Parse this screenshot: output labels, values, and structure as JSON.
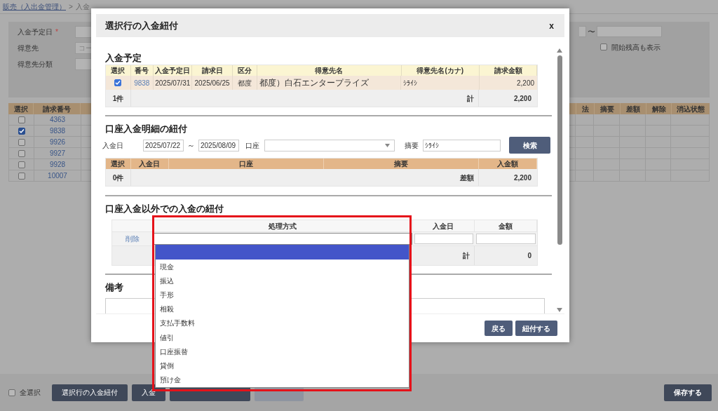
{
  "breadcrumb": {
    "link": "販売（入出金管理）",
    "separator": ">",
    "current": "入金"
  },
  "filter": {
    "fields": [
      {
        "label": "入金予定日",
        "required_mark": "*"
      },
      {
        "label": "得意先",
        "placeholder": "コー"
      },
      {
        "label": "得意先分類"
      }
    ],
    "range_separator": "〜",
    "opening_balance": {
      "label": "開始残高も表示",
      "checked": false
    }
  },
  "list": {
    "columns_left": [
      "選択",
      "請求番号"
    ],
    "columns_right": [
      "法",
      "摘要",
      "差額",
      "解除",
      "消込状態"
    ],
    "rows": [
      {
        "checked": false,
        "number": "4363"
      },
      {
        "checked": true,
        "number": "9838"
      },
      {
        "checked": false,
        "number": "9926"
      },
      {
        "checked": false,
        "number": "9927"
      },
      {
        "checked": false,
        "number": "9928"
      },
      {
        "checked": false,
        "number": "10007"
      }
    ]
  },
  "modal": {
    "title": "選択行の入金紐付",
    "close": "x",
    "schedule": {
      "heading": "入金予定",
      "columns": [
        "選択",
        "番号",
        "入金予定日",
        "請求日",
        "区分",
        "得意先名",
        "得意先名(カナ)",
        "請求金額"
      ],
      "rows": [
        {
          "selected": true,
          "number": "9838",
          "due": "2025/07/31",
          "billed": "2025/06/25",
          "category": "都度",
          "customer": "都度）白石エンタープライズ",
          "kana": "ｼﾗｲｼ",
          "amount": "2,200"
        }
      ],
      "count": "1件",
      "total_label": "計",
      "total": "2,200"
    },
    "bank": {
      "heading": "口座入金明細の紐付",
      "date_label": "入金日",
      "date_from": "2025/07/22",
      "range_separator": "～",
      "date_to": "2025/08/09",
      "account_label": "口座",
      "summary_label": "摘要",
      "summary_value": "ｼﾗｲｼ",
      "search_button": "検索",
      "columns": [
        "選択",
        "入金日",
        "口座",
        "摘要",
        "入金額"
      ],
      "count": "0件",
      "diff_label": "差額",
      "diff": "2,200"
    },
    "other": {
      "heading": "口座入金以外での入金の紐付",
      "columns": [
        "処理方式",
        "入金日",
        "金額"
      ],
      "delete_link": "削除",
      "total_label": "計",
      "total": "0"
    },
    "notes": {
      "heading": "備考"
    },
    "buttons": [
      "戻る",
      "紐付する"
    ]
  },
  "dropdown": {
    "blank_option": {
      "selected": true
    },
    "options": [
      {
        "label": "現金",
        "selected": false
      },
      {
        "label": "振込",
        "selected": false
      },
      {
        "label": "手形",
        "selected": false
      },
      {
        "label": "相殺",
        "selected": false
      },
      {
        "label": "支払手数料",
        "selected": false
      },
      {
        "label": "値引",
        "selected": false
      },
      {
        "label": "口座振替",
        "selected": false
      },
      {
        "label": "貸倒",
        "selected": false
      },
      {
        "label": "預け金",
        "selected": false
      }
    ]
  },
  "bottom_bar": {
    "select_all": {
      "label": "全選択",
      "checked": false
    },
    "buttons": [
      {
        "kind": "labeled",
        "label": "選択行の入金紐付"
      },
      {
        "kind": "labeled",
        "label": "入金"
      },
      {
        "kind": "obscured"
      },
      {
        "kind": "disabled"
      }
    ],
    "save": "保存する"
  }
}
